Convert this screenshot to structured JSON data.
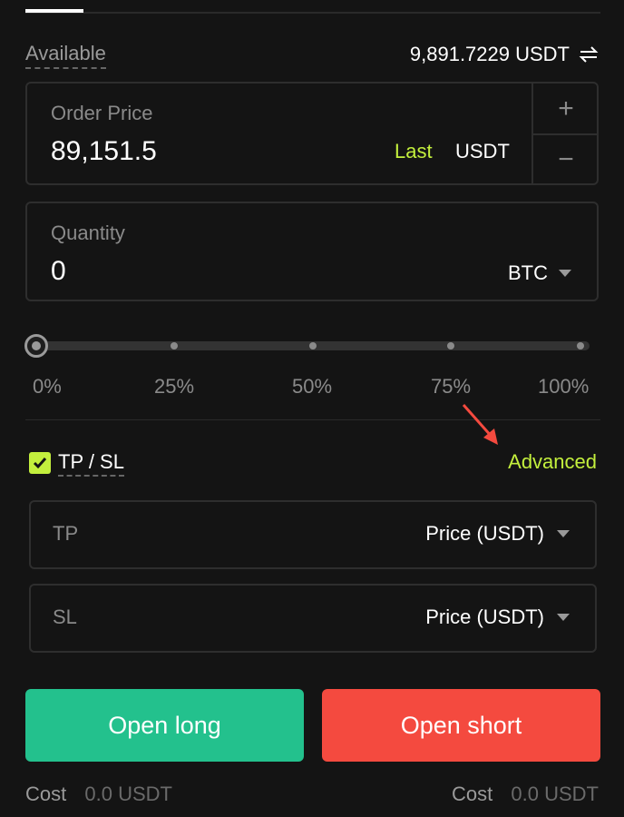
{
  "available": {
    "label": "Available",
    "value": "9,891.7229 USDT",
    "icon": "swap-icon"
  },
  "order_price": {
    "label": "Order Price",
    "value": "89,151.5",
    "last_label": "Last",
    "unit": "USDT",
    "plus": "+",
    "minus": "−"
  },
  "quantity": {
    "label": "Quantity",
    "value": "0",
    "unit": "BTC"
  },
  "slider": {
    "value_percent": 0,
    "marks": [
      "0%",
      "25%",
      "50%",
      "75%",
      "100%"
    ]
  },
  "tpsl": {
    "checked": true,
    "label": "TP / SL",
    "advanced_label": "Advanced"
  },
  "tp": {
    "label": "TP",
    "value": "Price (USDT)"
  },
  "sl": {
    "label": "SL",
    "value": "Price (USDT)"
  },
  "actions": {
    "long_label": "Open long",
    "short_label": "Open short"
  },
  "cost": {
    "label": "Cost",
    "long_value": "0.0 USDT",
    "short_value": "0.0 USDT"
  },
  "colors": {
    "accent": "#c3ef3d",
    "long": "#23c18d",
    "short": "#f44a3f",
    "background": "#141414",
    "annotation_arrow": "#f44a3f"
  }
}
